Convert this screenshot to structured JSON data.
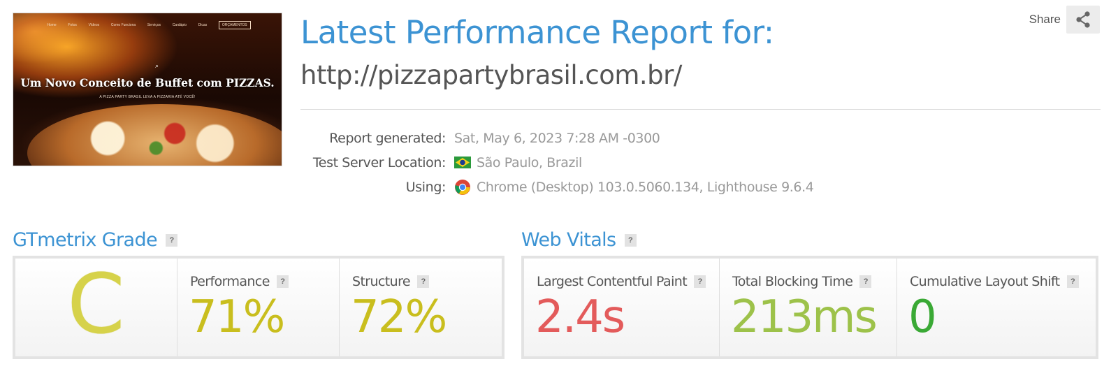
{
  "thumbnail": {
    "nav_items": [
      "Home",
      "Fotos",
      "Vídeos",
      "Como Funciona",
      "Serviços",
      "Cardápio",
      "Dicas",
      "ORÇAMENTOS"
    ],
    "headline": "Um Novo Conceito de Buffet com PIZZAS.",
    "subheadline": "A PIZZA PARTY BRASIL LEVA A PIZZARIA ATÉ VOCÊ!"
  },
  "header": {
    "title": "Latest Performance Report for:",
    "url": "http://pizzapartybrasil.com.br/",
    "share_label": "Share"
  },
  "meta": {
    "rows": [
      {
        "label": "Report generated:",
        "value": "Sat, May 6, 2023 7:28 AM -0300",
        "icon": ""
      },
      {
        "label": "Test Server Location:",
        "value": "São Paulo, Brazil",
        "icon": "brazil-flag-icon"
      },
      {
        "label": "Using:",
        "value": "Chrome (Desktop) 103.0.5060.134, Lighthouse 9.6.4",
        "icon": "chrome-icon"
      }
    ]
  },
  "grade": {
    "title": "GTmetrix Grade",
    "letter": "C",
    "letter_color": "#d6d24a",
    "metrics": [
      {
        "label": "Performance",
        "value": "71%",
        "color": "#c9be1e"
      },
      {
        "label": "Structure",
        "value": "72%",
        "color": "#c9be1e"
      }
    ]
  },
  "vitals": {
    "title": "Web Vitals",
    "metrics": [
      {
        "label": "Largest Contentful Paint",
        "value": "2.4s",
        "color": "#e35b5b"
      },
      {
        "label": "Total Blocking Time",
        "value": "213ms",
        "color": "#9dc24a"
      },
      {
        "label": "Cumulative Layout Shift",
        "value": "0",
        "color": "#3aa935"
      }
    ]
  },
  "colors": {
    "accent": "#3c93d3",
    "help_badge": "#e2e2e2"
  }
}
